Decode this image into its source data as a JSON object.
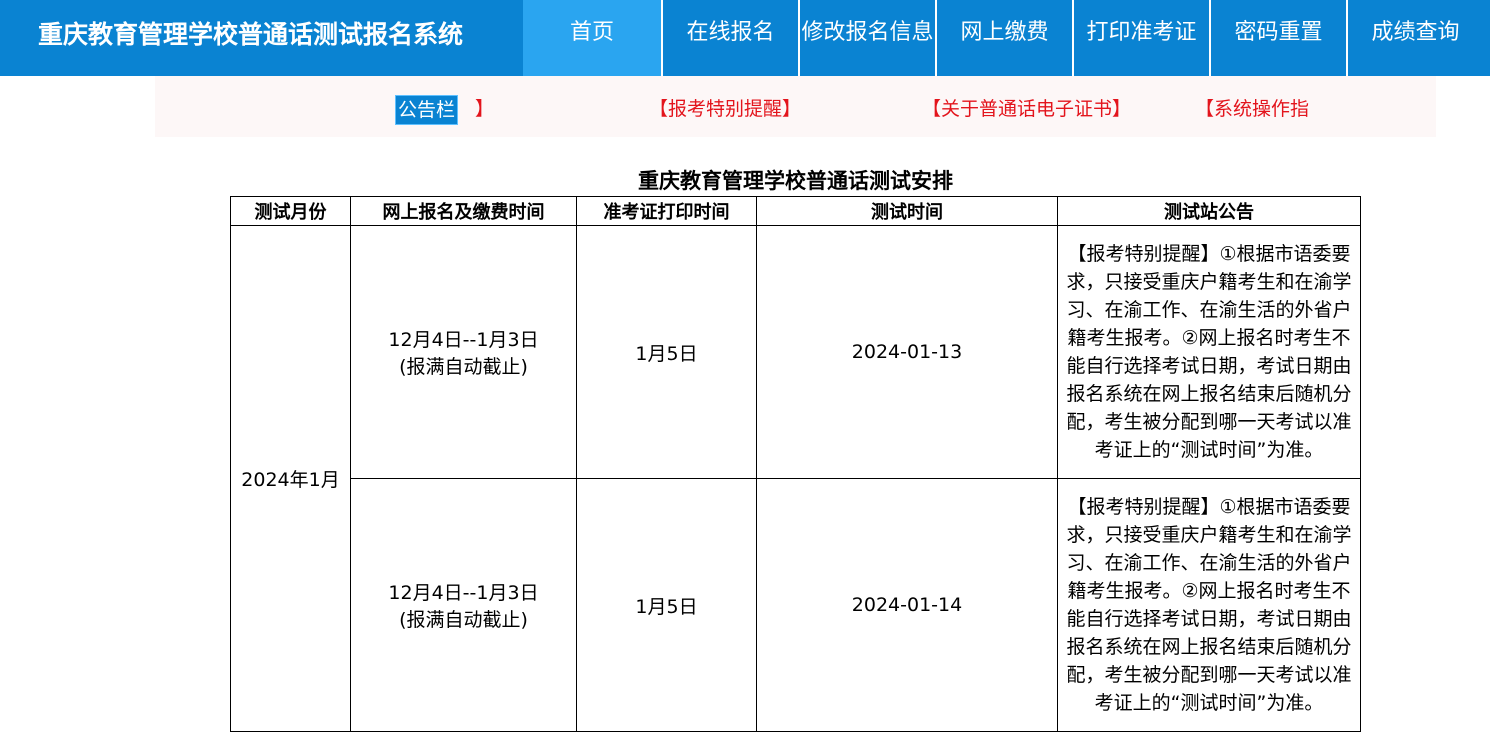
{
  "header": {
    "site_title": "重庆教育管理学校普通话测试报名系统",
    "nav": [
      "首页",
      "在线报名",
      "修改报名信息",
      "网上缴费",
      "打印准考证",
      "密码重置",
      "成绩查询"
    ],
    "active_nav": "首页"
  },
  "notice": {
    "label": "公告栏",
    "items": [
      "】",
      "【报考特别提醒】",
      "【关于普通话电子证书】",
      "【系统操作指"
    ]
  },
  "schedule": {
    "title": "重庆教育管理学校普通话测试安排",
    "headers": [
      "测试月份",
      "网上报名及缴费时间",
      "准考证打印时间",
      "测试时间",
      "测试站公告"
    ],
    "month": "2024年1月",
    "rows": [
      {
        "registration": "12月4日--1月3日",
        "registration_note": "(报满自动截止)",
        "ticket_print": "1月5日",
        "test_date": "2024-01-13",
        "announcement": "【报考特别提醒】①根据市语委要求，只接受重庆户籍考生和在渝学习、在渝工作、在渝生活的外省户籍考生报考。②网上报名时考生不能自行选择考试日期，考试日期由报名系统在网上报名结束后随机分配，考生被分配到哪一天考试以准考证上的“测试时间”为准。"
      },
      {
        "registration": "12月4日--1月3日",
        "registration_note": "(报满自动截止)",
        "ticket_print": "1月5日",
        "test_date": "2024-01-14",
        "announcement": "【报考特别提醒】①根据市语委要求，只接受重庆户籍考生和在渝学习、在渝工作、在渝生活的外省户籍考生报考。②网上报名时考生不能自行选择考试日期，考试日期由报名系统在网上报名结束后随机分配，考生被分配到哪一天考试以准考证上的“测试时间”为准。"
      }
    ]
  }
}
